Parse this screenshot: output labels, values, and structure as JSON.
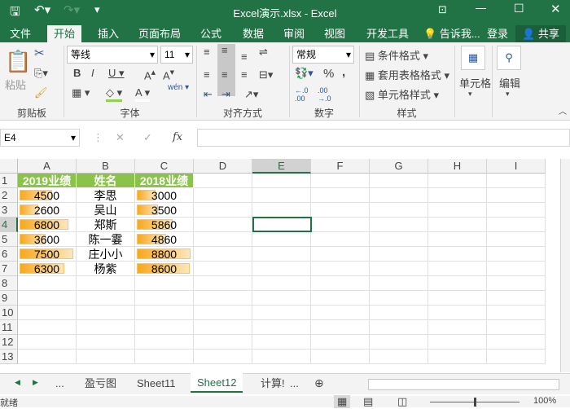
{
  "window": {
    "title": "Excel演示.xlsx - Excel"
  },
  "colors": {
    "brand": "#217346",
    "header_fill": "#8bc34a",
    "databar": "#f8a81d"
  },
  "menu_tabs": [
    "文件",
    "开始",
    "插入",
    "页面布局",
    "公式",
    "数据",
    "审阅",
    "视图",
    "开发工具"
  ],
  "active_tab": "开始",
  "tell_me": "告诉我...",
  "login": "登录",
  "share": "共享",
  "ribbon": {
    "paste": "粘贴",
    "font_name": "等线",
    "font_size": "11",
    "wen": "wén",
    "number_format": "常规",
    "conditional": "条件格式",
    "table_format": "套用表格格式",
    "cell_style": "单元格样式",
    "cells": "单元格",
    "edit": "编辑",
    "groups": [
      "剪贴板",
      "字体",
      "对齐方式",
      "数字",
      "样式"
    ],
    "percent": "%",
    "comma": ","
  },
  "formula_bar": {
    "name_box": "E4",
    "fx": "fx",
    "formula": ""
  },
  "columns": [
    "A",
    "B",
    "C",
    "D",
    "E",
    "F",
    "G",
    "H",
    "I"
  ],
  "rows": [
    "1",
    "2",
    "3",
    "4",
    "5",
    "6",
    "7",
    "8",
    "9",
    "10",
    "11",
    "12",
    "13"
  ],
  "table": {
    "headers": [
      "2019业绩",
      "姓名",
      "2018业绩"
    ],
    "rows": [
      {
        "a": "4500",
        "b": "李思",
        "c": "3000"
      },
      {
        "a": "2600",
        "b": "吴山",
        "c": "3500"
      },
      {
        "a": "6800",
        "b": "郑斯",
        "c": "5860"
      },
      {
        "a": "3600",
        "b": "陈一霎",
        "c": "4860"
      },
      {
        "a": "7500",
        "b": "庄小小",
        "c": "8800"
      },
      {
        "a": "6300",
        "b": "杨紫",
        "c": "8600"
      }
    ]
  },
  "selected_cell": "E4",
  "sheet_tabs": [
    "...",
    "盈亏图",
    "Sheet11",
    "Sheet12",
    "计算!",
    "..."
  ],
  "active_sheet": "Sheet12",
  "status": {
    "ready": "就绪",
    "zoom": "100%"
  }
}
